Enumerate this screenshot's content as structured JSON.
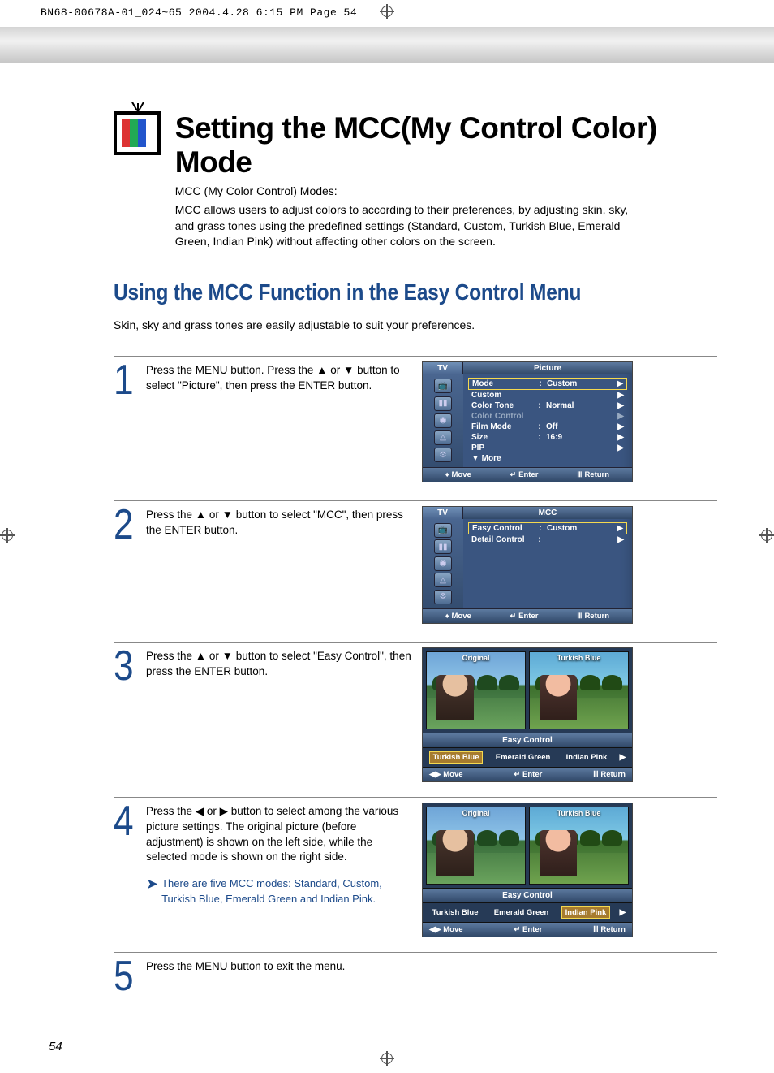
{
  "doc_header": "BN68-00678A-01_024~65  2004.4.28  6:15 PM  Page 54",
  "page_number": "54",
  "title": "Setting the MCC(My Control Color) Mode",
  "subtitle_label": "MCC (My Color Control) Modes:",
  "intro": "MCC allows users to adjust colors to according to their preferences, by adjusting skin, sky, and grass tones using the predefined settings (Standard, Custom, Turkish Blue, Emerald Green, Indian Pink) without affecting other colors on the screen.",
  "section_heading": "Using the MCC Function in the Easy Control Menu",
  "section_intro": "Skin, sky and grass tones are easily adjustable to suit your preferences.",
  "steps": {
    "s1": {
      "num": "1",
      "text": "Press the MENU button. Press the ▲ or ▼ button to select \"Picture\", then press the ENTER button."
    },
    "s2": {
      "num": "2",
      "text": "Press the ▲ or ▼ button to select \"MCC\", then press the ENTER button."
    },
    "s3": {
      "num": "3",
      "text": "Press the ▲ or ▼ button to select \"Easy Control\", then press the ENTER button."
    },
    "s4": {
      "num": "4",
      "text": "Press the ◀ or ▶ button to select among the various picture settings. The original picture (before adjustment) is shown on the left side, while the selected mode is shown on the right side.",
      "note_arrow": "➤",
      "note": "There are five MCC modes: Standard, Custom, Turkish Blue, Emerald Green and Indian Pink."
    },
    "s5": {
      "num": "5",
      "text": "Press the MENU button to exit the menu."
    }
  },
  "osd": {
    "tv": "TV",
    "picture": "Picture",
    "mcc": "MCC",
    "menu1": {
      "mode": "Mode",
      "mode_val": "Custom",
      "custom": "Custom",
      "colortone": "Color Tone",
      "colortone_val": "Normal",
      "colorcontrol": "Color Control",
      "filmmode": "Film Mode",
      "filmmode_val": "Off",
      "size": "Size",
      "size_val": "16:9",
      "pip": "PIP",
      "more": "▼ More"
    },
    "menu2": {
      "easy": "Easy Control",
      "easy_val": "Custom",
      "detail": "Detail Control"
    },
    "foot": {
      "move": "Move",
      "enter": "Enter",
      "return": "Return",
      "move_glyph_ud": "♦",
      "move_glyph_lr": "◀▶",
      "enter_glyph": "↵",
      "return_glyph": "🅼"
    },
    "preview": {
      "original": "Original",
      "turkish_label": "Turkish Blue",
      "easy_title": "Easy Control",
      "opt_turkish": "Turkish Blue",
      "opt_emerald": "Emerald Green",
      "opt_indian": "Indian Pink",
      "arrow": "▶"
    }
  }
}
